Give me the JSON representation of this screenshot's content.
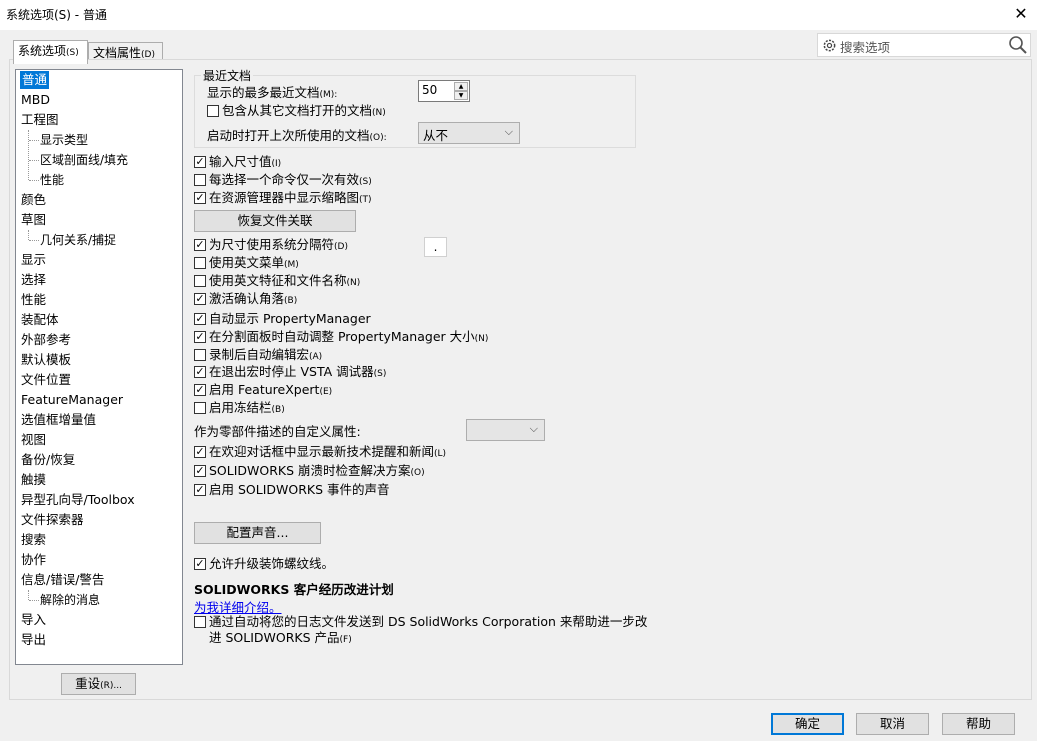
{
  "window": {
    "title": "系统选项(S) - 普通",
    "close": "✕"
  },
  "tabs": [
    {
      "label": "系统选项",
      "key": "(S)"
    },
    {
      "label": "文档属性",
      "key": "(D)"
    }
  ],
  "search": {
    "placeholder": "搜索选项"
  },
  "tree": {
    "items": [
      "普通",
      "MBD",
      "工程图",
      "显示类型",
      "区域剖面线/填充",
      "性能",
      "颜色",
      "草图",
      "几何关系/捕捉",
      "显示",
      "选择",
      "性能",
      "装配体",
      "外部参考",
      "默认模板",
      "文件位置",
      "FeatureManager",
      "选值框增量值",
      "视图",
      "备份/恢复",
      "触摸",
      "异型孔向导/Toolbox",
      "文件探索器",
      "搜索",
      "协作",
      "信息/错误/警告",
      "解除的消息",
      "导入",
      "导出"
    ]
  },
  "reset_button": {
    "label": "重设",
    "key": "(R)..."
  },
  "recent": {
    "group_title": "最近文档",
    "max_label": "显示的最多最近文档",
    "max_key": "(M):",
    "max_value": "50",
    "include_label": "包含从其它文档打开的文档",
    "include_key": "(N)",
    "startup_label": "启动时打开上次所使用的文档",
    "startup_key": "(O):",
    "startup_value": "从不"
  },
  "options": {
    "input_dim": {
      "label": "输入尺寸值",
      "key": "(I)",
      "checked": true
    },
    "single_cmd": {
      "label": "每选择一个命令仅一次有效",
      "key": "(S)",
      "checked": false
    },
    "thumbnails": {
      "label": "在资源管理器中显示缩略图",
      "key": "(T)",
      "checked": true
    },
    "restore_assoc": "恢复文件关联",
    "sys_sep": {
      "label": "为尺寸使用系统分隔符",
      "key": "(D)",
      "checked": true,
      "sep_value": "."
    },
    "eng_menu": {
      "label": "使用英文菜单",
      "key": "(M)",
      "checked": false
    },
    "eng_feat": {
      "label": "使用英文特征和文件名称",
      "key": "(N)",
      "checked": false
    },
    "confirm_corner": {
      "label": "激活确认角落",
      "key": "(B)",
      "checked": true
    },
    "auto_pm": {
      "label": "自动显示 PropertyManager",
      "checked": true
    },
    "split_pm": {
      "label": "在分割面板时自动调整 PropertyManager 大小",
      "key": "(N)",
      "checked": true
    },
    "macro_edit": {
      "label": "录制后自动编辑宏",
      "key": "(A)",
      "checked": false
    },
    "vsta": {
      "label": "在退出宏时停止 VSTA 调试器",
      "key": "(S)",
      "checked": true
    },
    "featurexpert": {
      "label": "启用 FeatureXpert",
      "key": "(E)",
      "checked": true
    },
    "freeze_bar": {
      "label": "启用冻结栏",
      "key": "(B)",
      "checked": false
    },
    "custom_prop_label": "作为零部件描述的自定义属性:",
    "custom_prop_value": "",
    "welcome_news": {
      "label": "在欢迎对话框中显示最新技术提醒和新闻",
      "key": "(L)",
      "checked": true
    },
    "crash_check": {
      "label": "SOLIDWORKS 崩溃时检查解决方案",
      "key": "(O)",
      "checked": true
    },
    "event_sounds": {
      "label": "启用 SOLIDWORKS 事件的声音",
      "checked": true
    },
    "config_sounds": "配置声音...",
    "upgrade_threads": {
      "label": "允许升级装饰螺纹线。",
      "checked": true
    }
  },
  "ceip": {
    "heading": "SOLIDWORKS 客户经历改进计划",
    "link": "为我详细介绍。",
    "send_line1": "通过自动将您的日志文件发送到 DS SolidWorks Corporation 来帮助进一步改",
    "send_line2": "进 SOLIDWORKS 产品",
    "send_key": "(F)",
    "checked": false
  },
  "footer": {
    "ok": "确定",
    "cancel": "取消",
    "help": "帮助"
  },
  "icons": {
    "check": "✓",
    "up": "▲",
    "down": "▼",
    "chevron": "⌵"
  },
  "colors": {
    "selection": "#0078d7",
    "link": "#0000ee"
  }
}
